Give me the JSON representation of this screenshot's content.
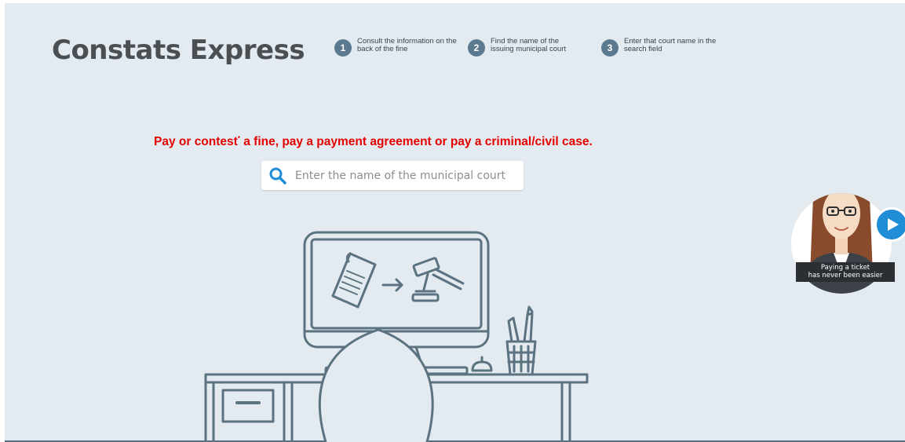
{
  "header": {
    "logo": "Constats Express",
    "steps": [
      {
        "number": "1",
        "text": "Consult the information on the back of the fine"
      },
      {
        "number": "2",
        "text": "Find the name of the issuing municipal court"
      },
      {
        "number": "3",
        "text": "Enter that court name in the search field"
      }
    ]
  },
  "main": {
    "headline_part1": "Pay or contest",
    "headline_mark": "*",
    "headline_part2": " a fine, pay a payment agreement or pay a criminal/civil case.",
    "search": {
      "placeholder": "Enter the name of the municipal court",
      "value": ""
    }
  },
  "assistant": {
    "caption_line1": "Paying a ticket",
    "caption_line2": "has never been easier"
  },
  "colors": {
    "background": "#e4ebf0",
    "headline": "#e60000",
    "step_badge": "#5b7a90",
    "accent_blue": "#1f8ed6",
    "illustration_stroke": "#5b7280"
  }
}
